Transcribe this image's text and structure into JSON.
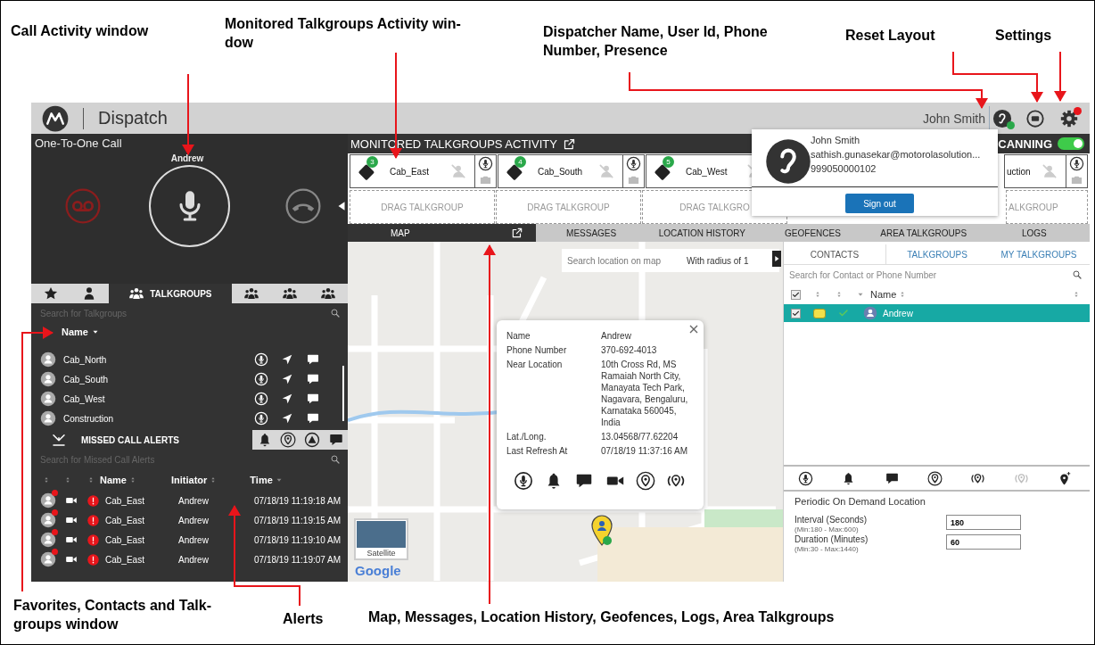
{
  "annotations": [
    {
      "lines": [
        "Call Activity window"
      ]
    },
    {
      "lines": [
        "Monitored  Talkgroups Activity  win-",
        "dow"
      ]
    },
    {
      "lines": [
        "Dispatcher Name, User Id, Phone",
        "Number, Presence"
      ]
    },
    {
      "lines": [
        "Reset Layout"
      ]
    },
    {
      "lines": [
        "Settings"
      ]
    },
    {
      "lines": [
        "Favorites, Contacts and Talk-",
        "groups window"
      ]
    },
    {
      "lines": [
        "Alerts"
      ]
    },
    {
      "lines": [
        "Map, Messages, Location History, Geofences, Logs, Area Talkgroups"
      ]
    }
  ],
  "header": {
    "app_name": "Dispatch",
    "user_name": "John Smith",
    "online": true,
    "settings_alert": true
  },
  "call": {
    "title": "One-To-One Call",
    "party": "Andrew"
  },
  "favorites_tabs": [
    {
      "kind": "star",
      "selected": false
    },
    {
      "kind": "person",
      "selected": false
    },
    {
      "kind": "group",
      "label": "TALKGROUPS",
      "selected": true
    },
    {
      "kind": "group-speaker",
      "selected": false
    },
    {
      "kind": "group",
      "selected": false
    },
    {
      "kind": "group-add",
      "selected": false
    }
  ],
  "talkgroups": {
    "search_placeholder": "Search for Talkgroups",
    "column": "Name",
    "rows": [
      "Cab_North",
      "Cab_South",
      "Cab_West",
      "Construction"
    ]
  },
  "alerts": {
    "tabs": [
      {
        "kind": "missed",
        "label": "MISSED CALL ALERTS",
        "selected": true
      },
      {
        "kind": "bell",
        "selected": false
      },
      {
        "kind": "pin",
        "selected": false
      },
      {
        "kind": "warning",
        "selected": false
      },
      {
        "kind": "chat",
        "selected": false
      }
    ],
    "search_placeholder": "Search for Missed Call Alerts",
    "columns": [
      "Name",
      "Initiator",
      "Time"
    ],
    "rows": [
      {
        "name": "Cab_East",
        "initiator": "Andrew",
        "time": "07/18/19 11:19:18 AM"
      },
      {
        "name": "Cab_East",
        "initiator": "Andrew",
        "time": "07/18/19 11:19:15 AM"
      },
      {
        "name": "Cab_East",
        "initiator": "Andrew",
        "time": "07/18/19 11:19:10 AM"
      },
      {
        "name": "Cab_East",
        "initiator": "Andrew",
        "time": "07/18/19 11:19:07 AM"
      }
    ]
  },
  "monitor": {
    "title": "MONITORED TALKGROUPS ACTIVITY",
    "scanning": {
      "label": "CANNING",
      "on": true
    },
    "tiles": [
      {
        "name": "Cab_East",
        "count": "3"
      },
      {
        "name": "Cab_South",
        "count": "4"
      },
      {
        "name": "Cab_West",
        "count": "5"
      },
      {
        "name": "uction"
      }
    ],
    "drop_slots": [
      "DRAG TALKGROUP",
      "DRAG TALKGROUP",
      "DRAG TALKGRO",
      "ALKGROUP"
    ]
  },
  "view_tabs": [
    {
      "label": "MAP",
      "selected": true
    },
    {
      "label": "MESSAGES",
      "selected": false
    },
    {
      "label": "LOCATION HISTORY",
      "selected": false
    },
    {
      "label": "GEOFENCES",
      "selected": false
    },
    {
      "label": "AREA TALKGROUPS",
      "selected": false
    },
    {
      "label": "LOGS",
      "selected": false
    }
  ],
  "map": {
    "search_placeholder": "Search location on map",
    "radius": "With radius of 1",
    "satellite": "Satellite",
    "attribution": "Google",
    "info": [
      {
        "label": "Name",
        "value": "Andrew"
      },
      {
        "label": "Phone Number",
        "value": "370-692-4013"
      },
      {
        "label": "Near Location",
        "value": "10th Cross Rd, MS Ramaiah North City, Manayata Tech Park, Nagavara, Bengaluru, Karnataka 560045, India"
      },
      {
        "label": "Lat./Long.",
        "value": "13.04568/77.62204"
      },
      {
        "label": "Last Refresh At",
        "value": "07/18/19 11:37:16 AM"
      }
    ]
  },
  "contacts": {
    "tabs": [
      {
        "label": "CONTACTS",
        "selected": true
      },
      {
        "label": "TALKGROUPS",
        "selected": false
      },
      {
        "label": "MY TALKGROUPS",
        "selected": false
      }
    ],
    "search_placeholder": "Search for Contact or Phone Number",
    "header_checked": true,
    "column": "Name",
    "rows": [
      {
        "name": "Andrew",
        "checked": true,
        "selected": true,
        "color": "#f2e04a"
      }
    ]
  },
  "pod": {
    "title": "Periodic On Demand Location",
    "fields": [
      {
        "label": "Interval (Seconds)",
        "hint": "(Min:180 - Max:600)",
        "value": "180"
      },
      {
        "label": "Duration (Minutes)",
        "hint": "(Min:30 - Max:1440)",
        "value": "60"
      }
    ]
  },
  "user_card": {
    "name": "John Smith",
    "email": "sathish.gunasekar@motorolasolution...",
    "phone": "999050000102",
    "button": "Sign out"
  }
}
